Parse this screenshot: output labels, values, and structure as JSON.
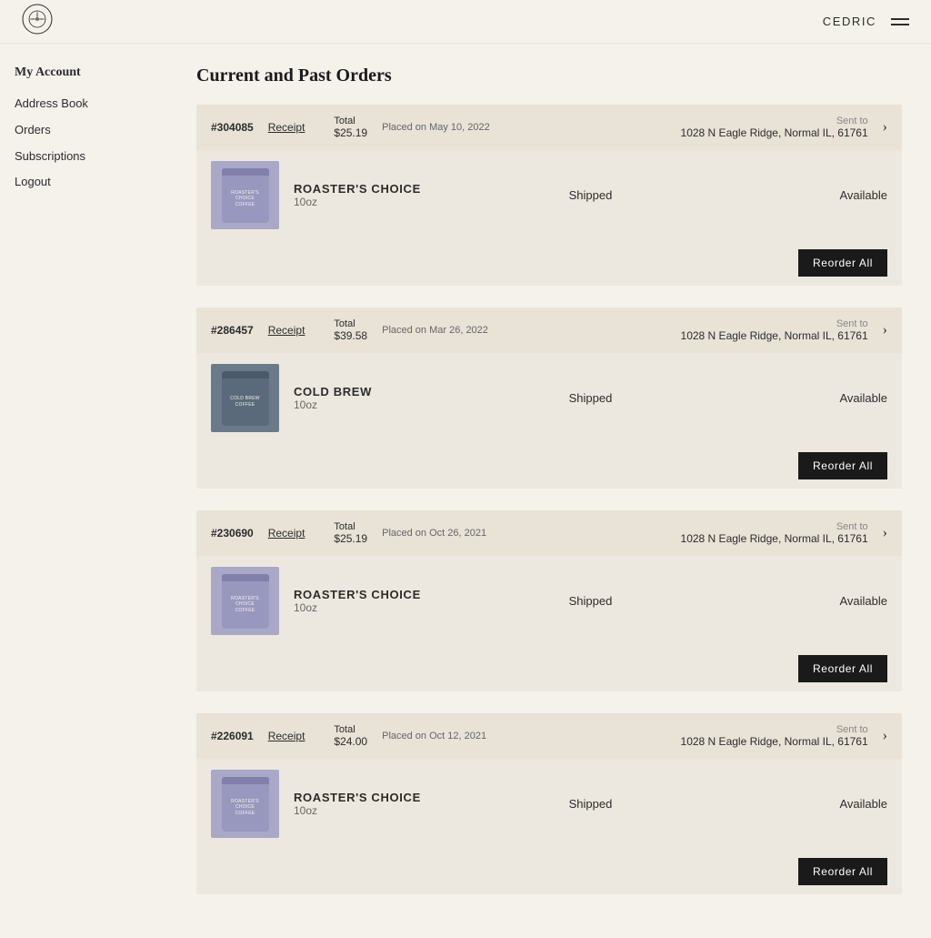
{
  "header": {
    "username": "CEDRIC",
    "menu_label": "menu"
  },
  "sidebar": {
    "title": "My Account",
    "nav_items": [
      {
        "label": "Address Book",
        "href": "#"
      },
      {
        "label": "Orders",
        "href": "#"
      },
      {
        "label": "Subscriptions",
        "href": "#"
      },
      {
        "label": "Logout",
        "href": "#"
      }
    ]
  },
  "main": {
    "page_title": "Current and Past Orders",
    "orders": [
      {
        "id": "order-304085",
        "number": "#304085",
        "receipt_label": "Receipt",
        "date": "Placed on May 10, 2022",
        "total_label": "Total",
        "total": "$25.19",
        "sent_to_label": "Sent to",
        "address": "1028 N Eagle Ridge, Normal IL, 61761",
        "items": [
          {
            "name": "ROASTER'S CHOICE",
            "size": "10oz",
            "status": "Shipped",
            "availability": "Available",
            "bag_type": "light",
            "bag_text": "ROASTER'S CHOICE"
          }
        ],
        "reorder_label": "Reorder All"
      },
      {
        "id": "order-286457",
        "number": "#286457",
        "receipt_label": "Receipt",
        "date": "Placed on Mar 26, 2022",
        "total_label": "Total",
        "total": "$39.58",
        "sent_to_label": "Sent to",
        "address": "1028 N Eagle Ridge, Normal IL, 61761",
        "items": [
          {
            "name": "COLD BREW",
            "size": "10oz",
            "status": "Shipped",
            "availability": "Available",
            "bag_type": "dark",
            "bag_text": "COLD BREW"
          }
        ],
        "reorder_label": "Reorder All"
      },
      {
        "id": "order-230690",
        "number": "#230690",
        "receipt_label": "Receipt",
        "date": "Placed on Oct 26, 2021",
        "total_label": "Total",
        "total": "$25.19",
        "sent_to_label": "Sent to",
        "address": "1028 N Eagle Ridge, Normal IL, 61761",
        "items": [
          {
            "name": "ROASTER'S CHOICE",
            "size": "10oz",
            "status": "Shipped",
            "availability": "Available",
            "bag_type": "light",
            "bag_text": "ROASTER'S CHOICE"
          }
        ],
        "reorder_label": "Reorder All"
      },
      {
        "id": "order-226091",
        "number": "#226091",
        "receipt_label": "Receipt",
        "date": "Placed on Oct 12, 2021",
        "total_label": "Total",
        "total": "$24.00",
        "sent_to_label": "Sent to",
        "address": "1028 N Eagle Ridge, Normal IL, 61761",
        "items": [
          {
            "name": "ROASTER'S CHOICE",
            "size": "10oz",
            "status": "Shipped",
            "availability": "Available",
            "bag_type": "light",
            "bag_text": "ROASTER'S CHOICE"
          }
        ],
        "reorder_label": "Reorder All"
      }
    ]
  }
}
